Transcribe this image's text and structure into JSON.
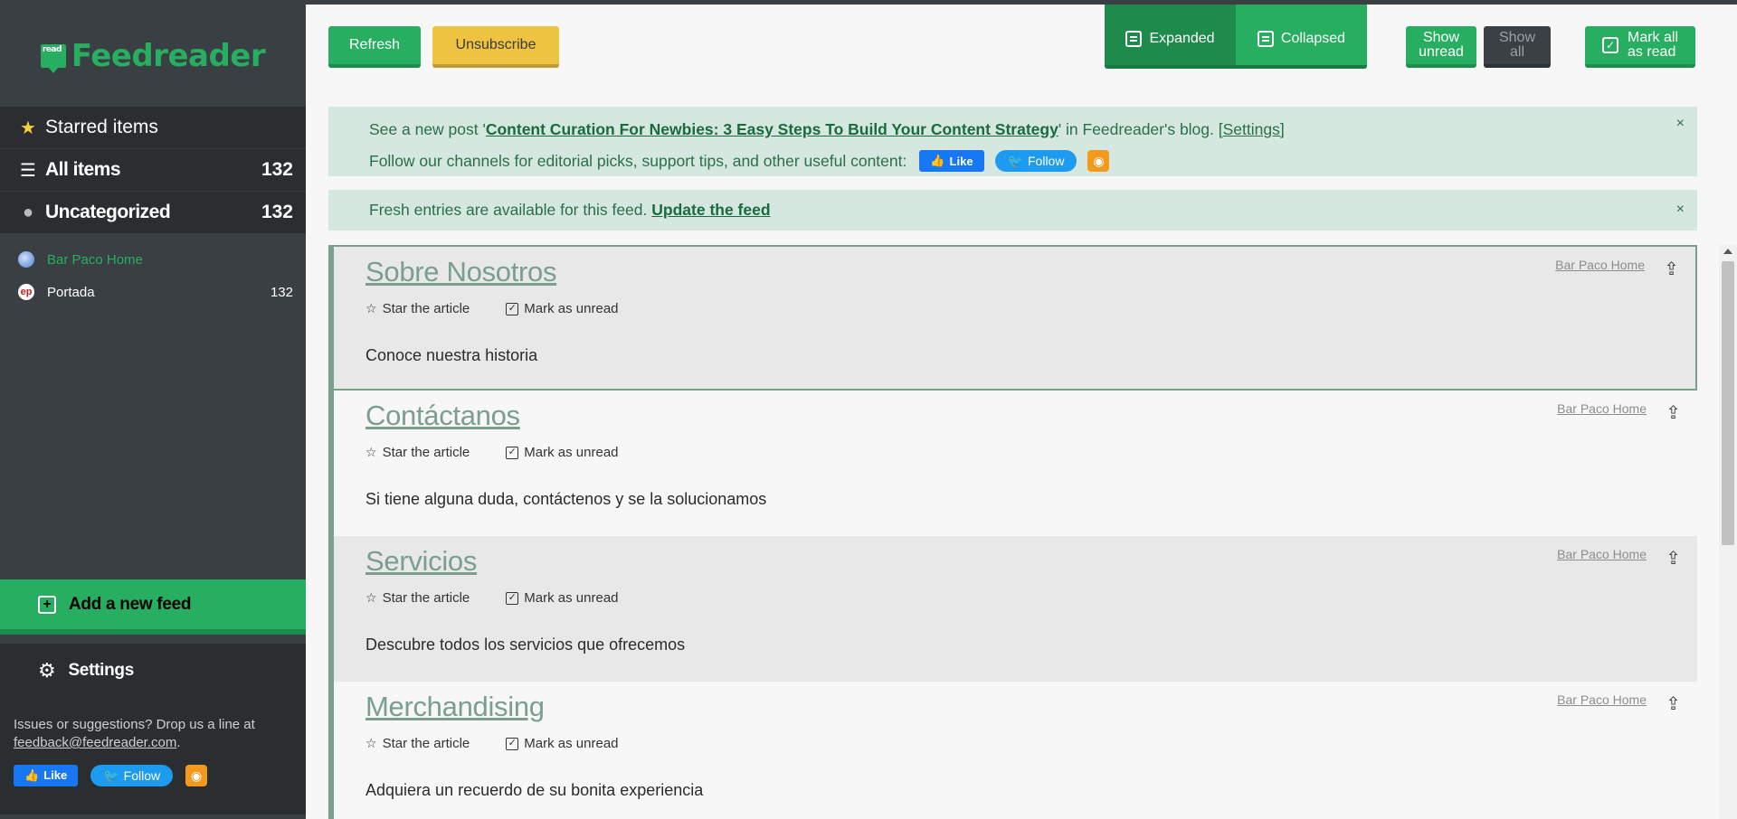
{
  "app": {
    "logo_badge": "read",
    "logo_text": "Feedreader"
  },
  "sidebar": {
    "nav": [
      {
        "label": "Starred items",
        "count": "",
        "icon": "star-icon"
      },
      {
        "label": "All items",
        "count": "132",
        "icon": "list-icon"
      },
      {
        "label": "Uncategorized",
        "count": "132",
        "icon": "dot-icon"
      }
    ],
    "feeds": [
      {
        "label": "Bar Paco Home",
        "count": "",
        "icon": "globe-icon",
        "active": true
      },
      {
        "label": "Portada",
        "count": "132",
        "icon": "ep-logo-icon",
        "active": false
      }
    ],
    "add_feed_label": "Add a new feed",
    "settings_label": "Settings",
    "footer_text": "Issues or suggestions? Drop us a line at",
    "footer_email": "feedback@feedreader.com",
    "footer_period": ".",
    "like_label": "Like",
    "follow_label": "Follow"
  },
  "toolbar": {
    "refresh": "Refresh",
    "unsubscribe": "Unsubscribe",
    "expanded": "Expanded",
    "collapsed": "Collapsed",
    "show_unread_1": "Show",
    "show_unread_2": "unread",
    "show_all_1": "Show",
    "show_all_2": "all",
    "mark_all_1": "Mark all",
    "mark_all_2": "as read"
  },
  "notice_blog": {
    "prefix": "See a new post '",
    "link": "Content Curation For Newbies: 3 Easy Steps To Build Your Content Strategy",
    "suffix": "' in Feedreader's blog.",
    "settings": "[Settings]",
    "follow_text": "Follow our channels for editorial picks, support tips, and other useful content:",
    "like": "Like",
    "follow": "Follow",
    "close": "×"
  },
  "notice_fresh": {
    "text": "Fresh entries are available for this feed.",
    "link": "Update the feed",
    "close": "×"
  },
  "articles": [
    {
      "title": "Sobre Nosotros",
      "star": "Star the article",
      "mark": "Mark as unread",
      "desc": "Conoce nuestra historia",
      "source": "Bar Paco Home"
    },
    {
      "title": "Contáctanos",
      "star": "Star the article",
      "mark": "Mark as unread",
      "desc": "Si tiene alguna duda, contáctenos y se la solucionamos",
      "source": "Bar Paco Home"
    },
    {
      "title": "Servicios",
      "star": "Star the article",
      "mark": "Mark as unread",
      "desc": "Descubre todos los servicios que ofrecemos",
      "source": "Bar Paco Home"
    },
    {
      "title": "Merchandising",
      "star": "Star the article",
      "mark": "Mark as unread",
      "desc": "Adquiera un recuerdo de su bonita experiencia",
      "source": "Bar Paco Home"
    }
  ],
  "colors": {
    "accent": "#27ae60",
    "sidebar": "#3a3f43",
    "notice": "#d4e8df",
    "title": "#7a9f8c"
  }
}
